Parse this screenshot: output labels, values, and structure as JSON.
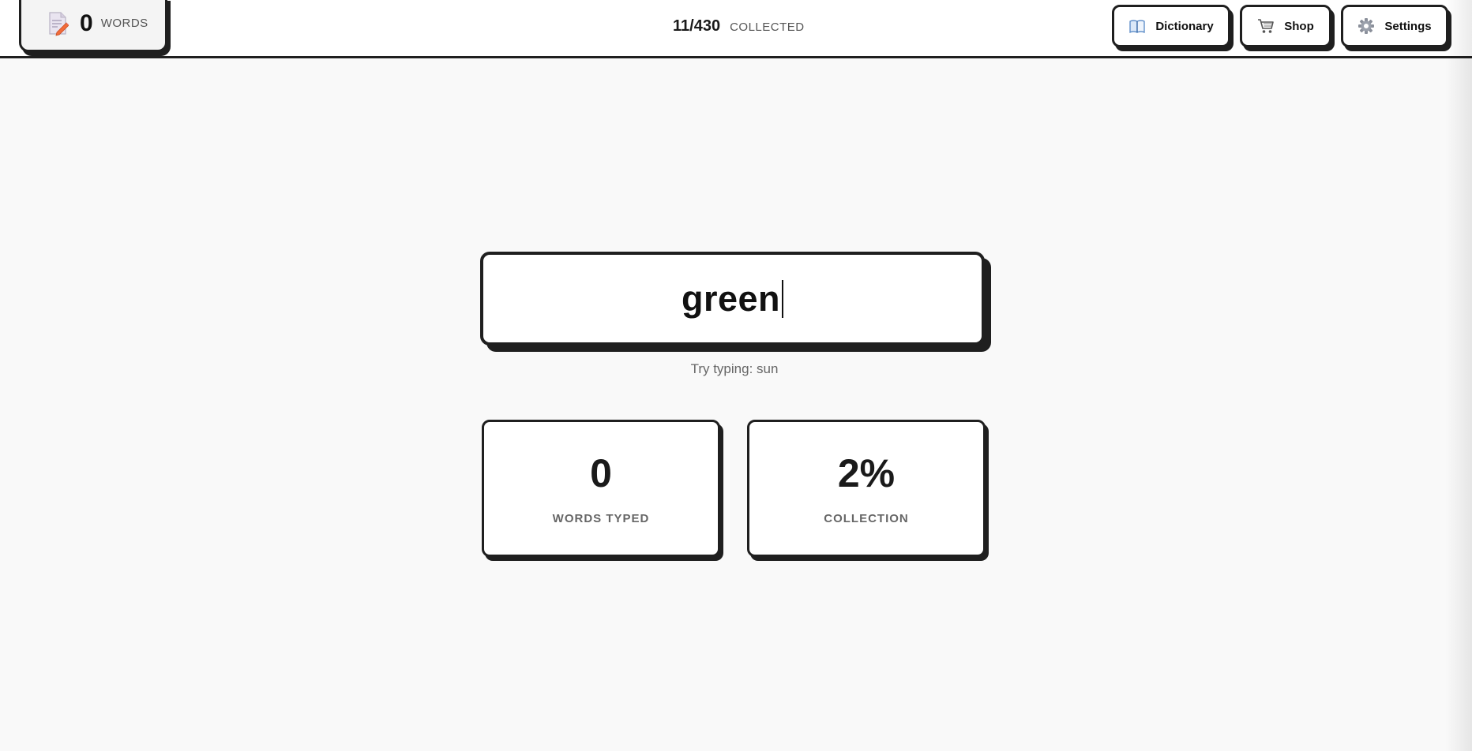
{
  "header": {
    "word_counter": {
      "value": "0",
      "label": "WORDS",
      "icon": "document-pencil-icon"
    },
    "collected": {
      "count": "11/430",
      "label": "COLLECTED"
    },
    "nav": [
      {
        "label": "Dictionary",
        "icon": "book-icon"
      },
      {
        "label": "Shop",
        "icon": "cart-icon"
      },
      {
        "label": "Settings",
        "icon": "gear-icon"
      }
    ]
  },
  "typing": {
    "current_word": "green",
    "hint": "Try typing: sun"
  },
  "stats": [
    {
      "value": "0",
      "label": "WORDS TYPED"
    },
    {
      "value": "2%",
      "label": "COLLECTION"
    }
  ],
  "colors": {
    "background": "#f9f9f9",
    "border": "#1f1f1f",
    "card": "#ffffff",
    "muted_text": "#666666"
  }
}
